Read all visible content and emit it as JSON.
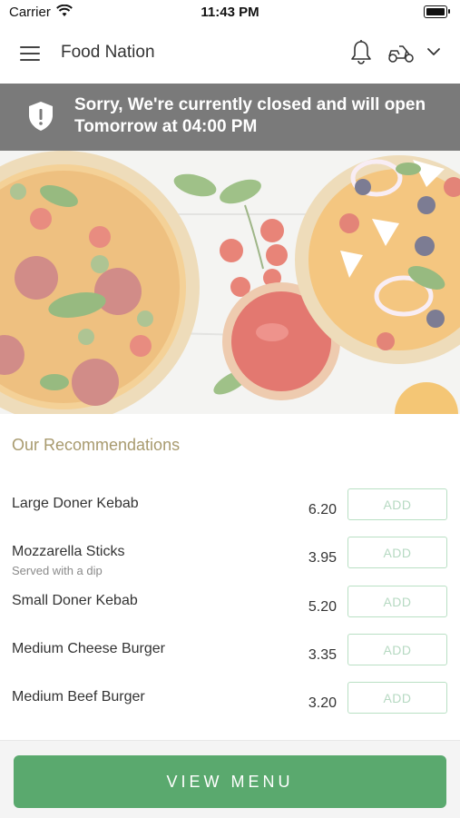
{
  "status_bar": {
    "carrier": "Carrier",
    "time": "11:43 PM"
  },
  "header": {
    "title": "Food Nation",
    "icons": [
      "menu-icon",
      "bell-icon",
      "scooter-icon",
      "chevron-down-icon"
    ]
  },
  "banner": {
    "message": "Sorry, We're currently closed and will open Tomorrow at 04:00 PM",
    "icon": "shield-alert-icon"
  },
  "recommendations": {
    "title": "Our Recommendations",
    "add_label": "ADD",
    "items": [
      {
        "name": "Large Doner Kebab",
        "subtitle": "",
        "price": "6.20"
      },
      {
        "name": "Mozzarella Sticks",
        "subtitle": "Served with a dip",
        "price": "3.95"
      },
      {
        "name": "Small Doner Kebab",
        "subtitle": "",
        "price": "5.20"
      },
      {
        "name": "Medium Cheese Burger",
        "subtitle": "",
        "price": "3.35"
      },
      {
        "name": "Medium Beef Burger",
        "subtitle": "",
        "price": "3.20"
      }
    ]
  },
  "footer": {
    "button_label": "VIEW MENU"
  },
  "colors": {
    "accent_green": "#5aa96e",
    "banner_gray": "#7a7a7a",
    "section_title": "#a89a6e"
  }
}
